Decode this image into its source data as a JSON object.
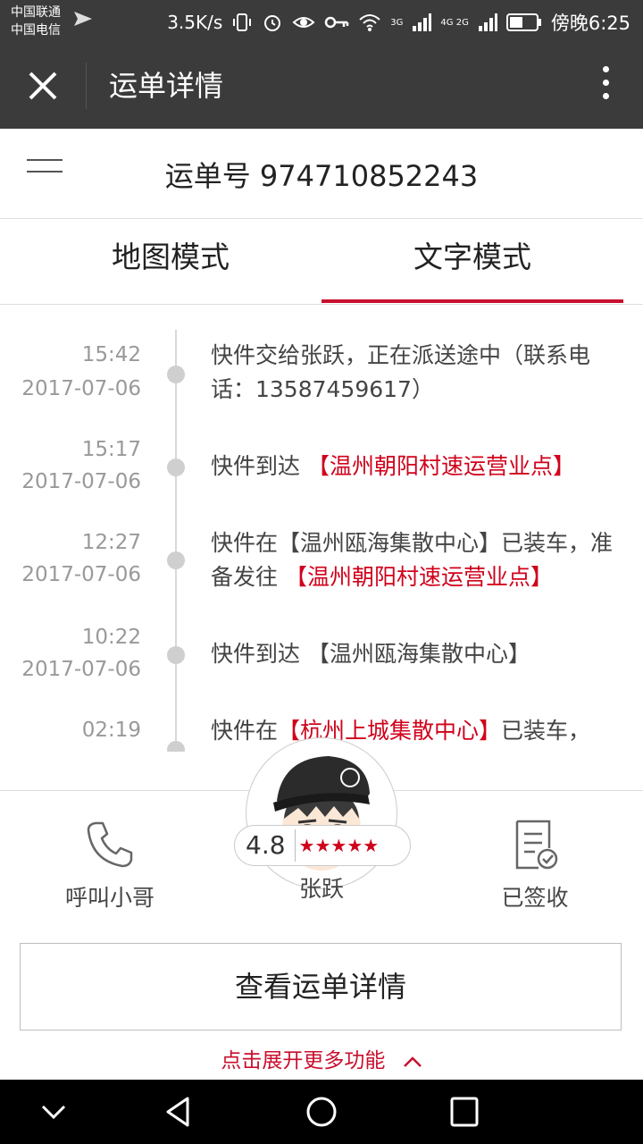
{
  "status_bar": {
    "carrier1": "中国联通",
    "carrier2": "中国电信",
    "speed": "3.5K/s",
    "time": "傍晚6:25",
    "network1": "3G",
    "network2": "4G 2G",
    "icons": [
      "vibrate-icon",
      "alarm-icon",
      "eye-icon",
      "key-icon",
      "wifi-icon",
      "signal-icon",
      "battery-icon"
    ]
  },
  "title_bar": {
    "title": "运单详情"
  },
  "waybill": {
    "label": "运单号 974710852243"
  },
  "tabs": [
    {
      "label": "地图模式",
      "active": false
    },
    {
      "label": "文字模式",
      "active": true
    }
  ],
  "timeline": [
    {
      "time": "15:42",
      "date": "2017-07-06",
      "desc_parts": [
        {
          "text": "快件交给张跃，正在派送途中（联系电话：13587459617）",
          "highlight": false
        }
      ]
    },
    {
      "time": "15:17",
      "date": "2017-07-06",
      "desc_parts": [
        {
          "text": "快件到达 ",
          "highlight": false
        },
        {
          "text": "【温州朝阳村速运营业点】",
          "highlight": true
        }
      ]
    },
    {
      "time": "12:27",
      "date": "2017-07-06",
      "desc_parts": [
        {
          "text": "快件在【温州瓯海集散中心】已装车，准备发往 ",
          "highlight": false
        },
        {
          "text": "【温州朝阳村速运营业点】",
          "highlight": true
        }
      ]
    },
    {
      "time": "10:22",
      "date": "2017-07-06",
      "desc_parts": [
        {
          "text": "快件到达 【温州瓯海集散中心】",
          "highlight": false
        }
      ]
    },
    {
      "time": "02:19",
      "date": "",
      "desc_parts": [
        {
          "text": "快件在",
          "highlight": false
        },
        {
          "text": "【杭州上城集散中心】",
          "highlight": true
        },
        {
          "text": "已装车，",
          "highlight": false
        }
      ]
    }
  ],
  "bottom": {
    "call_label": "呼叫小哥",
    "courier_name": "张跃",
    "rating": "4.8",
    "stars_filled": 5,
    "signed_label": "已签收",
    "detail_button": "查看运单详情",
    "expand_label": "点击展开更多功能"
  },
  "colors": {
    "accent": "#c8102e",
    "highlight_text": "#d0021b",
    "dark_bar": "#3b3b3b"
  }
}
